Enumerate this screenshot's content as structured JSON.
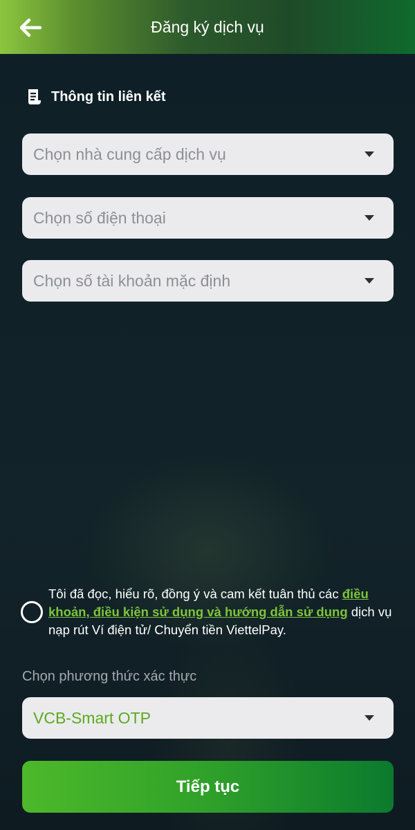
{
  "header": {
    "title": "Đăng ký dịch vụ",
    "back_icon": "arrow-left-icon"
  },
  "section": {
    "icon": "document-icon",
    "title": "Thông tin liên kết"
  },
  "selects": {
    "provider_placeholder": "Chọn nhà cung cấp dịch vụ",
    "phone_placeholder": "Chọn số điện thoại",
    "account_placeholder": "Chọn số tài khoản mặc định"
  },
  "agreement": {
    "checked": false,
    "text_before": "Tôi đã đọc, hiểu rõ, đồng ý và cam kết tuân thủ các ",
    "link_text": "điều khoản, điều kiện sử dụng và hướng dẫn sử dụng",
    "text_after": " dịch vụ nạp rút Ví điện tử/ Chuyển tiền ViettelPay."
  },
  "auth": {
    "label": "Chọn phương thức xác thực",
    "selected": "VCB-Smart OTP"
  },
  "actions": {
    "continue_label": "Tiếp tục"
  },
  "colors": {
    "accent_green": "#5caa1e",
    "link_green": "#7dc43b",
    "background": "#102028"
  }
}
